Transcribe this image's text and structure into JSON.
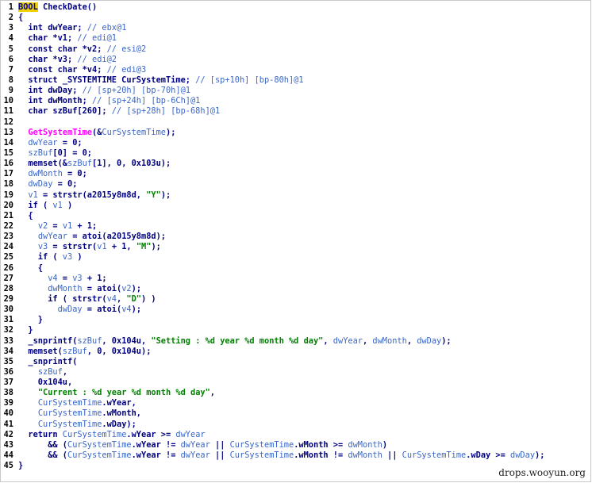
{
  "code_lines": [
    {
      "n": "1",
      "tokens": [
        [
          "hl",
          "BOOL"
        ],
        [
          "pl",
          " CheckDate()"
        ]
      ]
    },
    {
      "n": "2",
      "tokens": [
        [
          "pl",
          "{"
        ]
      ]
    },
    {
      "n": "3",
      "tokens": [
        [
          "pl",
          "  int dwYear; "
        ],
        [
          "cm",
          "// ebx@1"
        ]
      ]
    },
    {
      "n": "4",
      "tokens": [
        [
          "pl",
          "  char *v1; "
        ],
        [
          "cm",
          "// edi@1"
        ]
      ]
    },
    {
      "n": "5",
      "tokens": [
        [
          "pl",
          "  const char *v2; "
        ],
        [
          "cm",
          "// esi@2"
        ]
      ]
    },
    {
      "n": "6",
      "tokens": [
        [
          "pl",
          "  char *v3; "
        ],
        [
          "cm",
          "// edi@2"
        ]
      ]
    },
    {
      "n": "7",
      "tokens": [
        [
          "pl",
          "  const char *v4; "
        ],
        [
          "cm",
          "// edi@3"
        ]
      ]
    },
    {
      "n": "8",
      "tokens": [
        [
          "pl",
          "  struct _SYSTEMTIME CurSystemTime; "
        ],
        [
          "cm",
          "// [sp+10h] [bp-80h]@1"
        ]
      ]
    },
    {
      "n": "9",
      "tokens": [
        [
          "pl",
          "  int dwDay; "
        ],
        [
          "cm",
          "// [sp+20h] [bp-70h]@1"
        ]
      ]
    },
    {
      "n": "10",
      "tokens": [
        [
          "pl",
          "  int dwMonth; "
        ],
        [
          "cm",
          "// [sp+24h] [bp-6Ch]@1"
        ]
      ]
    },
    {
      "n": "11",
      "tokens": [
        [
          "pl",
          "  char szBuf[260]; "
        ],
        [
          "cm",
          "// [sp+28h] [bp-68h]@1"
        ]
      ]
    },
    {
      "n": "12",
      "tokens": [
        [
          "pl",
          ""
        ]
      ]
    },
    {
      "n": "13",
      "tokens": [
        [
          "pl",
          "  "
        ],
        [
          "fn",
          "GetSystemTime"
        ],
        [
          "pl",
          "(&"
        ],
        [
          "var",
          "CurSystemTime"
        ],
        [
          "pl",
          ");"
        ]
      ]
    },
    {
      "n": "14",
      "tokens": [
        [
          "pl",
          "  "
        ],
        [
          "var",
          "dwYear"
        ],
        [
          "pl",
          " = 0;"
        ]
      ]
    },
    {
      "n": "15",
      "tokens": [
        [
          "pl",
          "  "
        ],
        [
          "var",
          "szBuf"
        ],
        [
          "pl",
          "[0] = 0;"
        ]
      ]
    },
    {
      "n": "16",
      "tokens": [
        [
          "pl",
          "  memset(&"
        ],
        [
          "var",
          "szBuf"
        ],
        [
          "pl",
          "[1], 0, 0x103u);"
        ]
      ]
    },
    {
      "n": "17",
      "tokens": [
        [
          "pl",
          "  "
        ],
        [
          "var",
          "dwMonth"
        ],
        [
          "pl",
          " = 0;"
        ]
      ]
    },
    {
      "n": "18",
      "tokens": [
        [
          "pl",
          "  "
        ],
        [
          "var",
          "dwDay"
        ],
        [
          "pl",
          " = 0;"
        ]
      ]
    },
    {
      "n": "19",
      "tokens": [
        [
          "pl",
          "  "
        ],
        [
          "var",
          "v1"
        ],
        [
          "pl",
          " = strstr(a2015y8m8d, "
        ],
        [
          "str",
          "\"Y\""
        ],
        [
          "pl",
          ");"
        ]
      ]
    },
    {
      "n": "20",
      "tokens": [
        [
          "pl",
          "  if ( "
        ],
        [
          "var",
          "v1"
        ],
        [
          "pl",
          " )"
        ]
      ]
    },
    {
      "n": "21",
      "tokens": [
        [
          "pl",
          "  {"
        ]
      ]
    },
    {
      "n": "22",
      "tokens": [
        [
          "pl",
          "    "
        ],
        [
          "var",
          "v2"
        ],
        [
          "pl",
          " = "
        ],
        [
          "var",
          "v1"
        ],
        [
          "pl",
          " + 1;"
        ]
      ]
    },
    {
      "n": "23",
      "tokens": [
        [
          "pl",
          "    "
        ],
        [
          "var",
          "dwYear"
        ],
        [
          "pl",
          " = atoi(a2015y8m8d);"
        ]
      ]
    },
    {
      "n": "24",
      "tokens": [
        [
          "pl",
          "    "
        ],
        [
          "var",
          "v3"
        ],
        [
          "pl",
          " = strstr("
        ],
        [
          "var",
          "v1"
        ],
        [
          "pl",
          " + 1, "
        ],
        [
          "str",
          "\"M\""
        ],
        [
          "pl",
          ");"
        ]
      ]
    },
    {
      "n": "25",
      "tokens": [
        [
          "pl",
          "    if ( "
        ],
        [
          "var",
          "v3"
        ],
        [
          "pl",
          " )"
        ]
      ]
    },
    {
      "n": "26",
      "tokens": [
        [
          "pl",
          "    {"
        ]
      ]
    },
    {
      "n": "27",
      "tokens": [
        [
          "pl",
          "      "
        ],
        [
          "var",
          "v4"
        ],
        [
          "pl",
          " = "
        ],
        [
          "var",
          "v3"
        ],
        [
          "pl",
          " + 1;"
        ]
      ]
    },
    {
      "n": "28",
      "tokens": [
        [
          "pl",
          "      "
        ],
        [
          "var",
          "dwMonth"
        ],
        [
          "pl",
          " = atoi("
        ],
        [
          "var",
          "v2"
        ],
        [
          "pl",
          ");"
        ]
      ]
    },
    {
      "n": "29",
      "tokens": [
        [
          "pl",
          "      if ( strstr("
        ],
        [
          "var",
          "v4"
        ],
        [
          "pl",
          ", "
        ],
        [
          "str",
          "\"D\""
        ],
        [
          "pl",
          ") )"
        ]
      ]
    },
    {
      "n": "30",
      "tokens": [
        [
          "pl",
          "        "
        ],
        [
          "var",
          "dwDay"
        ],
        [
          "pl",
          " = atoi("
        ],
        [
          "var",
          "v4"
        ],
        [
          "pl",
          ");"
        ]
      ]
    },
    {
      "n": "31",
      "tokens": [
        [
          "pl",
          "    }"
        ]
      ]
    },
    {
      "n": "32",
      "tokens": [
        [
          "pl",
          "  }"
        ]
      ]
    },
    {
      "n": "33",
      "tokens": [
        [
          "pl",
          "  _snprintf("
        ],
        [
          "var",
          "szBuf"
        ],
        [
          "pl",
          ", 0x104u, "
        ],
        [
          "str",
          "\"Setting : %d year %d month %d day\""
        ],
        [
          "pl",
          ", "
        ],
        [
          "var",
          "dwYear"
        ],
        [
          "pl",
          ", "
        ],
        [
          "var",
          "dwMonth"
        ],
        [
          "pl",
          ", "
        ],
        [
          "var",
          "dwDay"
        ],
        [
          "pl",
          ");"
        ]
      ]
    },
    {
      "n": "34",
      "tokens": [
        [
          "pl",
          "  memset("
        ],
        [
          "var",
          "szBuf"
        ],
        [
          "pl",
          ", 0, 0x104u);"
        ]
      ]
    },
    {
      "n": "35",
      "tokens": [
        [
          "pl",
          "  _snprintf("
        ]
      ]
    },
    {
      "n": "36",
      "tokens": [
        [
          "pl",
          "    "
        ],
        [
          "var",
          "szBuf"
        ],
        [
          "pl",
          ","
        ]
      ]
    },
    {
      "n": "37",
      "tokens": [
        [
          "pl",
          "    0x104u,"
        ]
      ]
    },
    {
      "n": "38",
      "tokens": [
        [
          "pl",
          "    "
        ],
        [
          "str",
          "\"Current : %d year %d month %d day\""
        ],
        [
          "pl",
          ","
        ]
      ]
    },
    {
      "n": "39",
      "tokens": [
        [
          "pl",
          "    "
        ],
        [
          "var",
          "CurSystemTime"
        ],
        [
          "pl",
          ".wYear,"
        ]
      ]
    },
    {
      "n": "40",
      "tokens": [
        [
          "pl",
          "    "
        ],
        [
          "var",
          "CurSystemTime"
        ],
        [
          "pl",
          ".wMonth,"
        ]
      ]
    },
    {
      "n": "41",
      "tokens": [
        [
          "pl",
          "    "
        ],
        [
          "var",
          "CurSystemTime"
        ],
        [
          "pl",
          ".wDay);"
        ]
      ]
    },
    {
      "n": "42",
      "tokens": [
        [
          "pl",
          "  return "
        ],
        [
          "var",
          "CurSystemTime"
        ],
        [
          "pl",
          ".wYear >= "
        ],
        [
          "var",
          "dwYear"
        ]
      ]
    },
    {
      "n": "43",
      "tokens": [
        [
          "pl",
          "      && ("
        ],
        [
          "var",
          "CurSystemTime"
        ],
        [
          "pl",
          ".wYear != "
        ],
        [
          "var",
          "dwYear"
        ],
        [
          "pl",
          " || "
        ],
        [
          "var",
          "CurSystemTime"
        ],
        [
          "pl",
          ".wMonth >= "
        ],
        [
          "var",
          "dwMonth"
        ],
        [
          "pl",
          ")"
        ]
      ]
    },
    {
      "n": "44",
      "tokens": [
        [
          "pl",
          "      && ("
        ],
        [
          "var",
          "CurSystemTime"
        ],
        [
          "pl",
          ".wYear != "
        ],
        [
          "var",
          "dwYear"
        ],
        [
          "pl",
          " || "
        ],
        [
          "var",
          "CurSystemTime"
        ],
        [
          "pl",
          ".wMonth != "
        ],
        [
          "var",
          "dwMonth"
        ],
        [
          "pl",
          " || "
        ],
        [
          "var",
          "CurSystemTime"
        ],
        [
          "pl",
          ".wDay >= "
        ],
        [
          "var",
          "dwDay"
        ],
        [
          "pl",
          ");"
        ]
      ]
    },
    {
      "n": "45",
      "tokens": [
        [
          "pl",
          "}"
        ]
      ]
    }
  ],
  "watermark": "drops.wooyun.org",
  "colors": {
    "keyword": "#000080",
    "variable": "#3a66c8",
    "comment": "#3a66c8",
    "function": "#ff00ff",
    "string": "#008000",
    "highlight": "#f0d000"
  }
}
